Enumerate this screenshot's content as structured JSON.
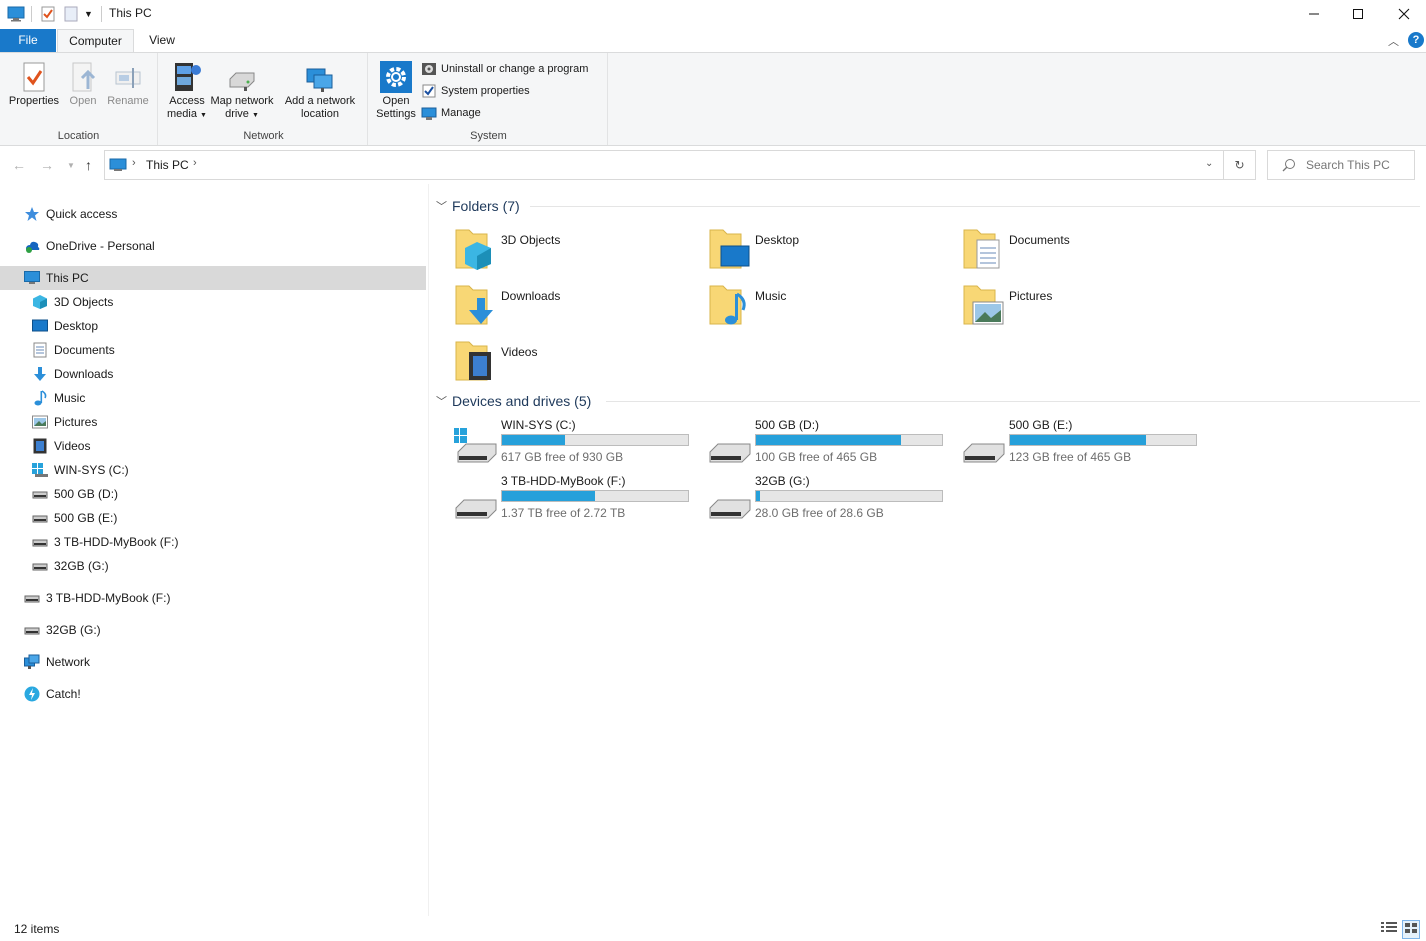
{
  "window": {
    "title": "This PC"
  },
  "colors": {
    "accent": "#1979ca",
    "drive_bar": "#26a0da",
    "selection": "#d9d9d9",
    "folder": "#f8d775"
  },
  "ribbon": {
    "tabs": [
      "File",
      "Computer",
      "View"
    ],
    "location": {
      "label": "Location",
      "properties": "Properties",
      "open": "Open",
      "rename": "Rename"
    },
    "network": {
      "label": "Network",
      "access_media": [
        "Access",
        "media"
      ],
      "map_drive": [
        "Map network",
        "drive"
      ],
      "add_location": [
        "Add a network",
        "location"
      ]
    },
    "system": {
      "label": "System",
      "open_settings": [
        "Open",
        "Settings"
      ],
      "uninstall": "Uninstall or change a program",
      "system_properties": "System properties",
      "manage": "Manage"
    }
  },
  "address": {
    "root": "This PC",
    "search_placeholder": "Search This PC"
  },
  "navpane": {
    "quick_access": "Quick access",
    "onedrive": "OneDrive - Personal",
    "this_pc": "This PC",
    "this_pc_children": [
      {
        "label": "3D Objects",
        "icon": "3d-objects-icon"
      },
      {
        "label": "Desktop",
        "icon": "desktop-icon"
      },
      {
        "label": "Documents",
        "icon": "documents-icon"
      },
      {
        "label": "Downloads",
        "icon": "downloads-icon"
      },
      {
        "label": "Music",
        "icon": "music-icon"
      },
      {
        "label": "Pictures",
        "icon": "pictures-icon"
      },
      {
        "label": "Videos",
        "icon": "videos-icon"
      },
      {
        "label": "WIN-SYS (C:)",
        "icon": "windows-drive-icon"
      },
      {
        "label": "500 GB (D:)",
        "icon": "drive-icon"
      },
      {
        "label": "500 GB (E:)",
        "icon": "drive-icon"
      },
      {
        "label": "3 TB-HDD-MyBook (F:)",
        "icon": "drive-icon"
      },
      {
        "label": "32GB (G:)",
        "icon": "drive-icon"
      }
    ],
    "drive_f": "3 TB-HDD-MyBook (F:)",
    "drive_g": "32GB (G:)",
    "network": "Network",
    "catch": "Catch!"
  },
  "content": {
    "folders_header": "Folders (7)",
    "folders": [
      "3D Objects",
      "Desktop",
      "Documents",
      "Downloads",
      "Music",
      "Pictures",
      "Videos"
    ],
    "drives_header": "Devices and drives (5)",
    "drives": [
      {
        "name": "WIN-SYS (C:)",
        "free": "617 GB free of 930 GB",
        "used_fraction": 0.34
      },
      {
        "name": "500 GB (D:)",
        "free": "100 GB free of 465 GB",
        "used_fraction": 0.78
      },
      {
        "name": "500 GB (E:)",
        "free": "123 GB free of 465 GB",
        "used_fraction": 0.73
      },
      {
        "name": "3 TB-HDD-MyBook (F:)",
        "free": "1.37 TB free of 2.72 TB",
        "used_fraction": 0.5
      },
      {
        "name": "32GB (G:)",
        "free": "28.0 GB free of 28.6 GB",
        "used_fraction": 0.02
      }
    ]
  },
  "status": {
    "items": "12 items"
  }
}
